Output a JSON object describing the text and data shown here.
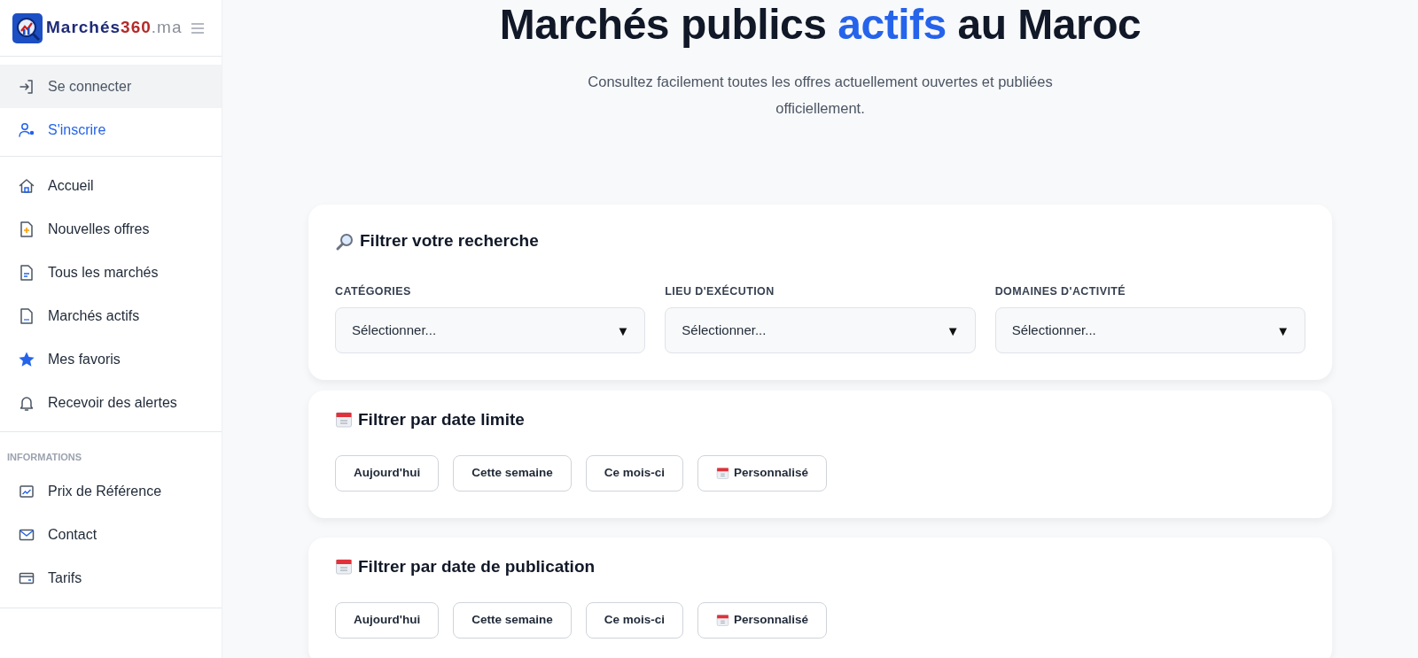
{
  "brand": {
    "name": "Marchés",
    "number": "360",
    "suffix": ".ma"
  },
  "auth_items": [
    {
      "label": "Se connecter",
      "selected": true,
      "emphasized": false
    },
    {
      "label": "S'inscrire",
      "selected": false,
      "emphasized": true
    }
  ],
  "nav_items": [
    {
      "label": "Accueil"
    },
    {
      "label": "Nouvelles offres"
    },
    {
      "label": "Tous les marchés"
    },
    {
      "label": "Marchés actifs"
    },
    {
      "label": "Mes favoris"
    },
    {
      "label": "Recevoir des alertes"
    }
  ],
  "info_section": {
    "heading": "INFORMATIONS",
    "items": [
      {
        "label": "Prix de Référence"
      },
      {
        "label": "Contact"
      },
      {
        "label": "Tarifs"
      }
    ]
  },
  "hero": {
    "title_start": "Marchés publics ",
    "title_highlight": "actifs",
    "title_end": " au Maroc",
    "subtitle": "Consultez facilement toutes les offres actuellement ouvertes et publiées officiellement."
  },
  "search_filter": {
    "title": "Filtrer votre recherche",
    "fields": [
      {
        "label": "CATÉGORIES",
        "placeholder": "Sélectionner...",
        "arrow": "▼"
      },
      {
        "label": "LIEU D'EXÉCUTION",
        "placeholder": "Sélectionner...",
        "arrow": "▼"
      },
      {
        "label": "DOMAINES D'ACTIVITÉ",
        "placeholder": "Sélectionner...",
        "arrow": "▼"
      }
    ]
  },
  "date_filters": [
    {
      "title": "Filtrer par date limite",
      "buttons": [
        {
          "label": "Aujourd'hui",
          "kind": "plain"
        },
        {
          "label": "Cette semaine",
          "kind": "plain"
        },
        {
          "label": "Ce mois-ci",
          "kind": "plain"
        },
        {
          "label": "Personnalisé",
          "kind": "custom"
        }
      ]
    },
    {
      "title": "Filtrer par date de publication",
      "buttons": [
        {
          "label": "Aujourd'hui",
          "kind": "plain"
        },
        {
          "label": "Cette semaine",
          "kind": "plain"
        },
        {
          "label": "Ce mois-ci",
          "kind": "plain"
        },
        {
          "label": "Personnalisé",
          "kind": "custom"
        }
      ]
    }
  ]
}
